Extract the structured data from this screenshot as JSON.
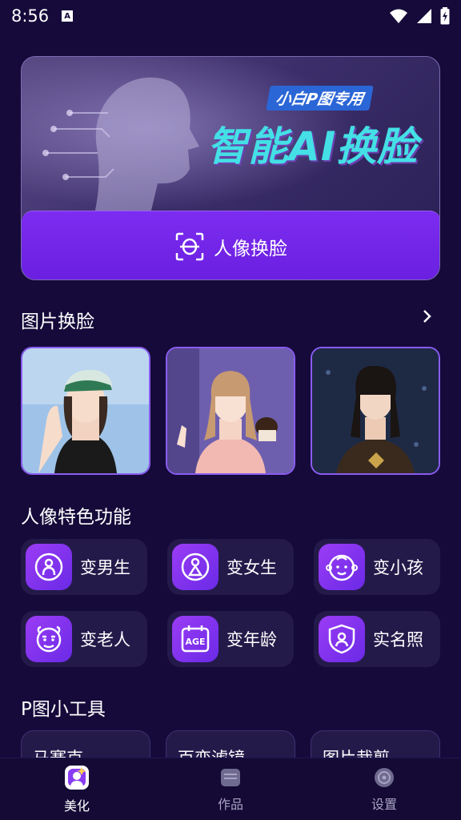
{
  "status_bar": {
    "time": "8:56",
    "notification_badge": "A"
  },
  "banner": {
    "subtitle": "小白P图专用",
    "title": "智能AI换脸",
    "button_label": "人像换脸"
  },
  "photo_section": {
    "title": "图片换脸",
    "photos": [
      {
        "name": "girl-with-cap"
      },
      {
        "name": "girl-with-cake"
      },
      {
        "name": "girl-dark-hair"
      }
    ]
  },
  "features_section": {
    "title": "人像特色功能",
    "items": [
      {
        "label": "变男生",
        "icon": "male-avatar-icon"
      },
      {
        "label": "变女生",
        "icon": "female-avatar-icon"
      },
      {
        "label": "变小孩",
        "icon": "child-face-icon"
      },
      {
        "label": "变老人",
        "icon": "old-face-icon"
      },
      {
        "label": "变年龄",
        "icon": "age-calendar-icon"
      },
      {
        "label": "实名照",
        "icon": "id-photo-icon"
      }
    ]
  },
  "tools_section": {
    "title": "P图小工具",
    "items": [
      {
        "label": "马赛克"
      },
      {
        "label": "百变滤镜"
      },
      {
        "label": "图片裁剪"
      }
    ]
  },
  "bottom_nav": {
    "items": [
      {
        "label": "美化",
        "active": true
      },
      {
        "label": "作品",
        "active": false
      },
      {
        "label": "设置",
        "active": false
      }
    ]
  },
  "colors": {
    "background": "#150a3a",
    "accent": "#7c2cf0",
    "card": "#241a4a",
    "banner_title": "#44e0e6"
  }
}
